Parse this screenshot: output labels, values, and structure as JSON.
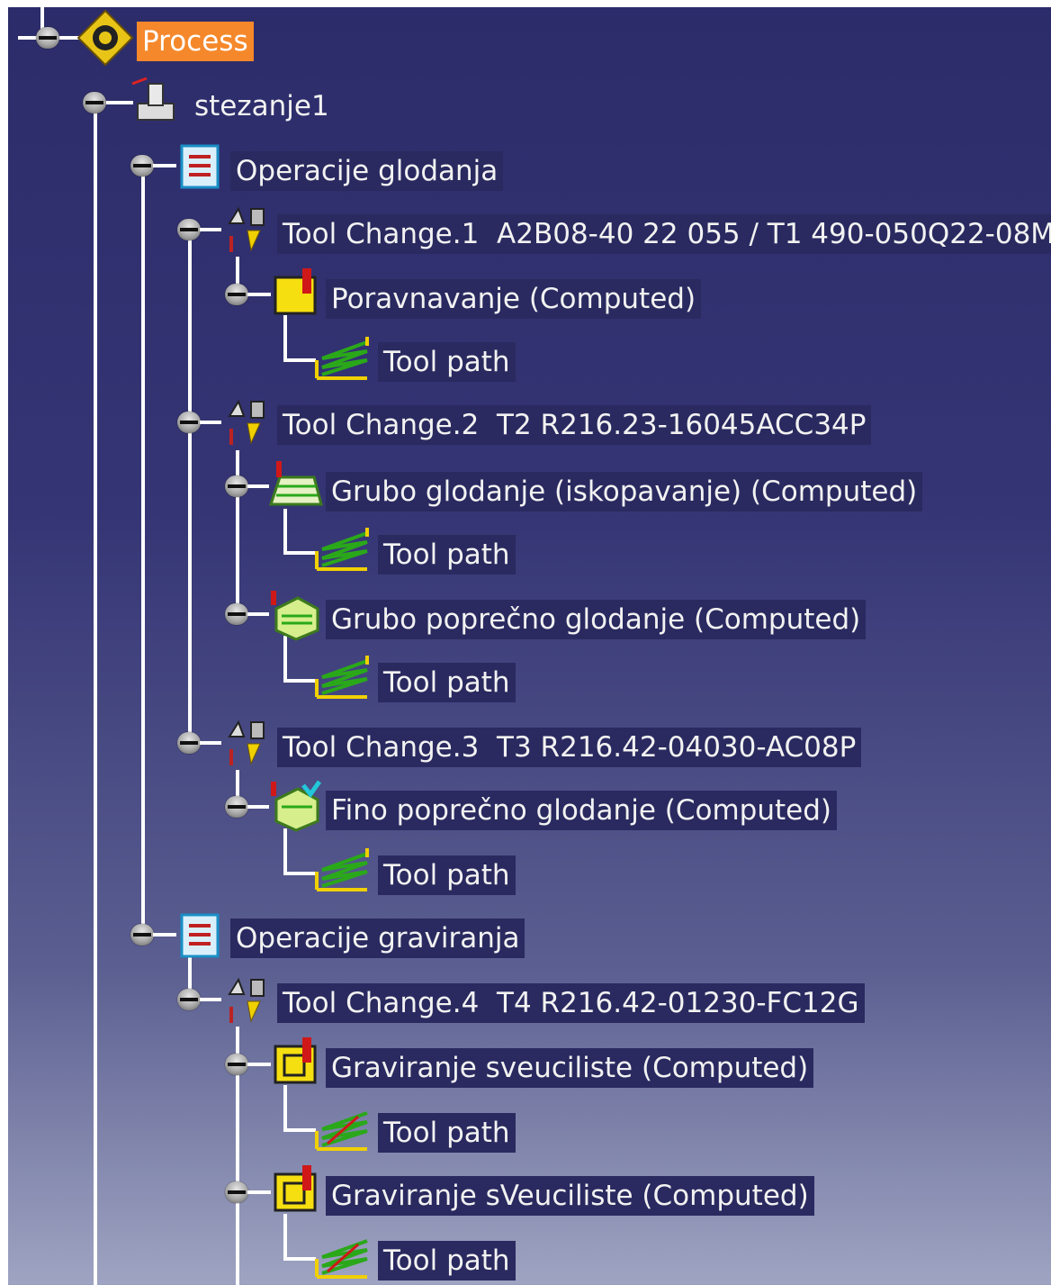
{
  "colors": {
    "background_top": "#2c2c6a",
    "background_bottom": "#9fa4c2",
    "label_background": "#2a2a60",
    "selected_background": "#f5882b",
    "label_text": "#f2f2f2",
    "tree_line": "#ffffff"
  },
  "tree": {
    "process": {
      "label": "Process",
      "icon": "process-icon",
      "selected": true
    },
    "setup": {
      "label": "stezanje1",
      "icon": "part-operation-icon"
    },
    "program1": {
      "label": "Operacije glodanja",
      "icon": "manufacturing-program-icon",
      "tool_change_1": {
        "label": "Tool Change.1  A2B08-40 22 055 / T1 490-050Q22-08M",
        "icon": "tool-change-icon"
      },
      "op1": {
        "label": "Poravnavanje (Computed)",
        "icon": "facing-operation-icon",
        "toolpath": "Tool path"
      },
      "tool_change_2": {
        "label": "Tool Change.2  T2 R216.23-16045ACC34P",
        "icon": "tool-change-icon"
      },
      "op2": {
        "label": "Grubo glodanje (iskopavanje) (Computed)",
        "icon": "roughing-operation-icon",
        "toolpath": "Tool path"
      },
      "op3": {
        "label": "Grubo poprečno glodanje (Computed)",
        "icon": "sweeping-operation-icon",
        "toolpath": "Tool path"
      },
      "tool_change_3": {
        "label": "Tool Change.3  T3 R216.42-04030-AC08P",
        "icon": "tool-change-icon"
      },
      "op4": {
        "label": "Fino poprečno glodanje (Computed)",
        "icon": "finishing-sweep-operation-icon",
        "toolpath": "Tool path"
      }
    },
    "program2": {
      "label": "Operacije graviranja",
      "icon": "manufacturing-program-icon",
      "tool_change_4": {
        "label": "Tool Change.4  T4 R216.42-01230-FC12G",
        "icon": "tool-change-icon"
      },
      "op5": {
        "label": "Graviranje sveuciliste (Computed)",
        "icon": "engraving-operation-icon",
        "toolpath": "Tool path"
      },
      "op6": {
        "label": "Graviranje sVeuciliste (Computed)",
        "icon": "engraving-operation-icon",
        "toolpath": "Tool path"
      }
    }
  }
}
